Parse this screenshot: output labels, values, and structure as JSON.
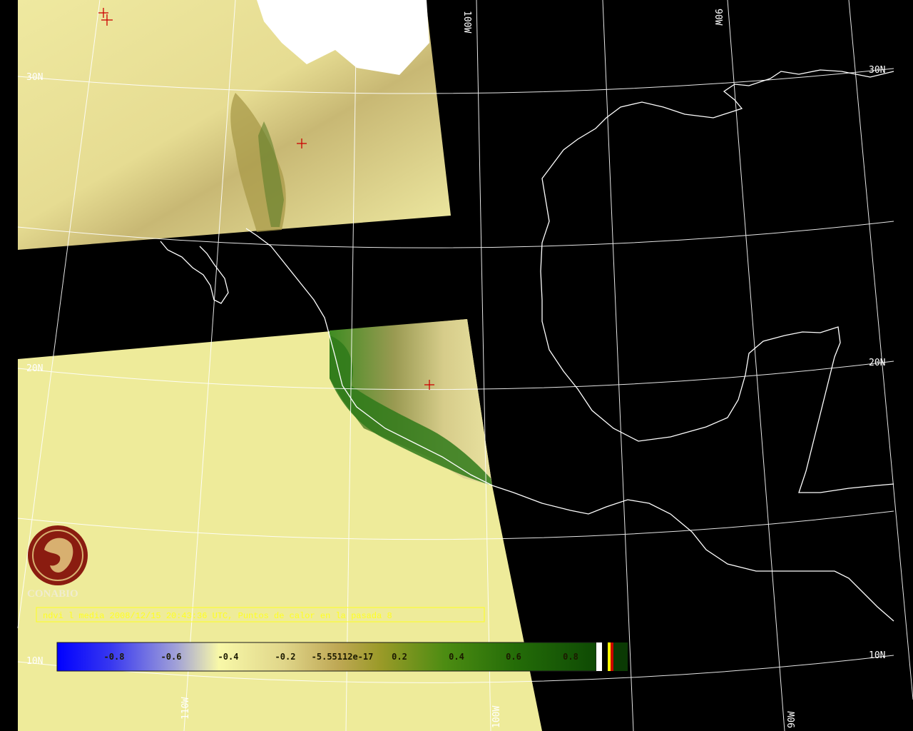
{
  "map": {
    "title_line": "ndvi l media 2008/12/15 20:43:36 UTC, Puntos de calor en la pasada 8",
    "logo_text": "CONABIO",
    "logo_icon": "conabio-macaw-logo",
    "background_color": "#000000",
    "no_data_color": "#eeeb9a",
    "coastline_color": "#ffffff",
    "graticule_color": "#ffffff",
    "hotspot_marker_color": "#cc0000",
    "hotspot_marker_icon": "plus-icon"
  },
  "graticule_labels": {
    "lat_30n_left": "30N",
    "lat_30n_right": "30N",
    "lat_20n_left": "20N",
    "lat_20n_right": "20N",
    "lat_10n_left": "10N",
    "lat_10n_right": "10N",
    "lon_100w_top": "100W",
    "lon_90w_top": "90W",
    "lon_110w_bottom": "110W",
    "lon_100w_bottom": "100W",
    "lon_90w_bottom": "90W"
  },
  "colorbar": {
    "ticks": [
      "-0.8",
      "-0.6",
      "-0.4",
      "-0.2",
      "-5.55112e-17",
      "0.2",
      "0.4",
      "0.6",
      "0.8"
    ],
    "gradient_colors": [
      "#0000ff",
      "#7878d8",
      "#f8f8a8",
      "#d8cc80",
      "#b89848",
      "#8a9a20",
      "#3c8a10",
      "#1e6a08",
      "#104a04"
    ],
    "extra_swatches": [
      "#ffffff",
      "#000000",
      "#ffff00",
      "#cc0000",
      "#0b3a04"
    ]
  },
  "hotspots_count": 4
}
